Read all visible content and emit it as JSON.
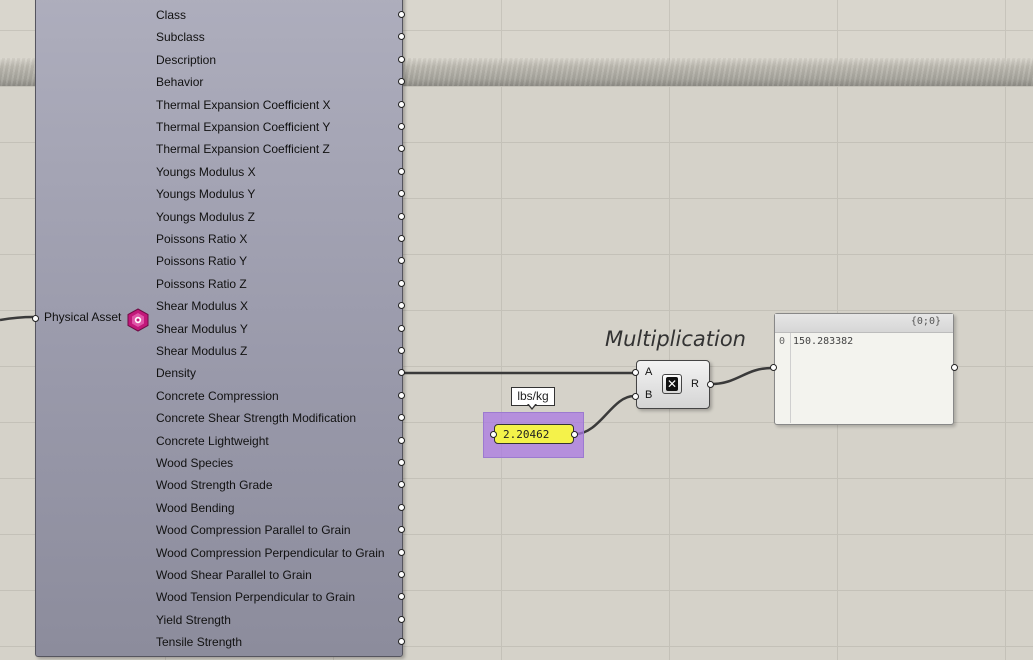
{
  "asset_node": {
    "input_label": "Physical Asset",
    "outputs": [
      "Class",
      "Subclass",
      "Description",
      "Behavior",
      "Thermal Expansion Coefficient X",
      "Thermal Expansion Coefficient Y",
      "Thermal Expansion Coefficient Z",
      "Youngs Modulus X",
      "Youngs Modulus Y",
      "Youngs Modulus Z",
      "Poissons Ratio X",
      "Poissons Ratio Y",
      "Poissons Ratio Z",
      "Shear Modulus X",
      "Shear Modulus Y",
      "Shear Modulus Z",
      "Density",
      "Concrete Compression",
      "Concrete Shear Strength Modification",
      "Concrete Lightweight",
      "Wood Species",
      "Wood Strength Grade",
      "Wood Bending",
      "Wood Compression Parallel to Grain",
      "Wood Compression Perpendicular to Grain",
      "Wood Shear Parallel to Grain",
      "Wood Tension Perpendicular to Grain",
      "Yield Strength",
      "Tensile Strength"
    ],
    "icon": "hexagon-asset-icon",
    "icon_color": "#c2187a"
  },
  "multiplication": {
    "title": "Multiplication",
    "input_a": "A",
    "input_b": "B",
    "output_r": "R",
    "icon": "multiply-icon"
  },
  "number": {
    "value": "2.20462",
    "tooltip": "lbs/kg"
  },
  "panel": {
    "path": "{0;0}",
    "index": "0",
    "value": "150.283382"
  },
  "colors": {
    "canvas": "#d5d2c9",
    "component": "#a0a0b0",
    "number_fill": "#f4f24a",
    "group_fill": "#aa78e1"
  }
}
